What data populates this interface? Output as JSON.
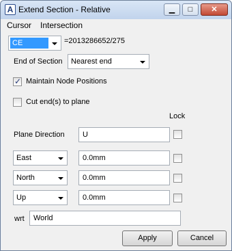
{
  "window": {
    "title": "Extend Section - Relative",
    "icon": "A",
    "controls": {
      "minimize": "▁",
      "maximize": "□",
      "close": "✕"
    }
  },
  "menu": {
    "items": [
      "Cursor",
      "Intersection"
    ]
  },
  "element": {
    "type_value": "CE",
    "reference": "=2013286652/275"
  },
  "end_of_section": {
    "label": "End of Section",
    "value": "Nearest end"
  },
  "maintain_node_positions": {
    "label": "Maintain Node Positions",
    "checked": true
  },
  "cut_ends": {
    "label": "Cut end(s) to plane",
    "checked": false
  },
  "lock_header": "Lock",
  "plane_direction": {
    "label": "Plane Direction",
    "value": "U"
  },
  "offsets": [
    {
      "direction": "East",
      "value": "0.0mm"
    },
    {
      "direction": "North",
      "value": "0.0mm"
    },
    {
      "direction": "Up",
      "value": "0.0mm"
    }
  ],
  "wrt": {
    "label": "wrt",
    "value": "World"
  },
  "buttons": {
    "apply": "Apply",
    "cancel": "Cancel"
  },
  "colors": {
    "selection": "#3399ff",
    "dialog_bg": "#f0f0f0",
    "check": "#2b3e7a"
  }
}
